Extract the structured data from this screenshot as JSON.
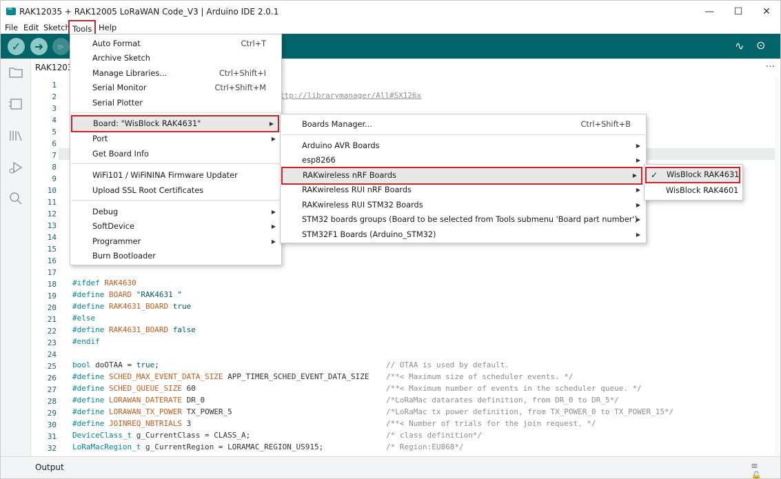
{
  "window": {
    "title": "RAK12035 + RAK12005 LoRaWAN Code_V3 | Arduino IDE 2.0.1",
    "controls": {
      "minimize": "—",
      "maximize": "☐",
      "close": "✕"
    }
  },
  "menubar": {
    "file": "File",
    "edit": "Edit",
    "sketch": "Sketch",
    "tools": "Tools",
    "help": "Help"
  },
  "toolbar": {
    "verify": "✓",
    "upload": "➜",
    "debug": "⊳",
    "serial_plotter": "∿",
    "serial_monitor": "⊙"
  },
  "editor": {
    "tab_name": "RAK12035 + RAK12005 LoRaWAN Code_V3.ino",
    "more_actions": "···",
    "visible_url_fragment": "ttp://librarymanager/All#SX126x",
    "lines": [
      {
        "n": "1"
      },
      {
        "n": "2"
      },
      {
        "n": "3"
      },
      {
        "n": "4"
      },
      {
        "n": "5"
      },
      {
        "n": "6"
      },
      {
        "n": "7"
      },
      {
        "n": "8"
      },
      {
        "n": "9"
      },
      {
        "n": "10"
      },
      {
        "n": "11"
      },
      {
        "n": "12"
      },
      {
        "n": "13"
      },
      {
        "n": "14"
      },
      {
        "n": "15"
      },
      {
        "n": "16"
      },
      {
        "n": "17"
      },
      {
        "n": "18"
      },
      {
        "n": "19"
      },
      {
        "n": "20"
      },
      {
        "n": "21"
      },
      {
        "n": "22"
      },
      {
        "n": "23"
      },
      {
        "n": "24"
      },
      {
        "n": "25"
      },
      {
        "n": "26"
      },
      {
        "n": "27"
      },
      {
        "n": "28"
      },
      {
        "n": "29"
      },
      {
        "n": "30"
      },
      {
        "n": "31"
      },
      {
        "n": "32"
      }
    ],
    "code": {
      "l18": {
        "a": "#ifdef ",
        "b": "RAK4630"
      },
      "l19": {
        "a": "#define ",
        "b": "BOARD ",
        "c": "\"RAK4631 \""
      },
      "l20": {
        "a": "#define ",
        "b": "RAK4631_BOARD ",
        "c": "true"
      },
      "l21": {
        "a": "#else"
      },
      "l22": {
        "a": "#define ",
        "b": "RAK4631_BOARD ",
        "c": "false"
      },
      "l23": {
        "a": "#endif"
      },
      "l25": {
        "a": "bool ",
        "b": "doOTAA = ",
        "c": "true",
        ";": ";",
        "cm": "// OTAA is used by default."
      },
      "l26": {
        "a": "#define ",
        "b": "SCHED_MAX_EVENT_DATA_SIZE ",
        "c": "APP_TIMER_SCHED_EVENT_DATA_SIZE ",
        "cm": "/**< Maximum size of scheduler events. */"
      },
      "l27": {
        "a": "#define ",
        "b": "SCHED_QUEUE_SIZE ",
        "c": "60",
        "cm": "/**< Maximum number of events in the scheduler queue. */"
      },
      "l28": {
        "a": "#define ",
        "b": "LORAWAN_DATERATE ",
        "c": "DR_0",
        "cm": "/*LoRaMac datarates definition, from DR_0 to DR_5*/"
      },
      "l29": {
        "a": "#define ",
        "b": "LORAWAN_TX_POWER ",
        "c": "TX_POWER_5",
        "cm": "/*LoRaMac tx power definition, from TX_POWER_0 to TX_POWER_15*/"
      },
      "l30": {
        "a": "#define ",
        "b": "JOINREQ_NBTRIALS ",
        "c": "3",
        "cm": "/**< Number of trials for the join request. */"
      },
      "l31": {
        "a": "DeviceClass_t ",
        "b": "g_CurrentClass = CLASS_A;",
        "cm": "/* class definition*/"
      },
      "l32": {
        "a": "LoRaMacRegion_t ",
        "b": "g_CurrentRegion = LORAMAC_REGION_US915;",
        "cm": "/* Region:EU868*/"
      }
    }
  },
  "tools_menu": {
    "items": [
      {
        "label": "Auto Format",
        "shortcut": "Ctrl+T"
      },
      {
        "label": "Archive Sketch",
        "shortcut": ""
      },
      {
        "label": "Manage Libraries...",
        "shortcut": "Ctrl+Shift+I"
      },
      {
        "label": "Serial Monitor",
        "shortcut": "Ctrl+Shift+M"
      },
      {
        "label": "Serial Plotter",
        "shortcut": ""
      },
      {
        "label": "Board: \"WisBlock RAK4631\"",
        "shortcut": ""
      },
      {
        "label": "Port",
        "shortcut": ""
      },
      {
        "label": "Get Board Info",
        "shortcut": ""
      },
      {
        "label": "WiFi101 / WiFiNINA Firmware Updater",
        "shortcut": ""
      },
      {
        "label": "Upload SSL Root Certificates",
        "shortcut": ""
      },
      {
        "label": "Debug",
        "shortcut": ""
      },
      {
        "label": "SoftDevice",
        "shortcut": ""
      },
      {
        "label": "Programmer",
        "shortcut": ""
      },
      {
        "label": "Burn Bootloader",
        "shortcut": ""
      }
    ],
    "submenu_arrow": "▶"
  },
  "boards_submenu": {
    "items": [
      {
        "label": "Boards Manager...",
        "shortcut": "Ctrl+Shift+B"
      },
      {
        "label": "Arduino AVR Boards"
      },
      {
        "label": "esp8266"
      },
      {
        "label": "RAKwireless nRF Boards"
      },
      {
        "label": "RAKwireless RUI nRF Boards"
      },
      {
        "label": "RAKwireless RUI STM32 Boards"
      },
      {
        "label": "STM32 boards groups (Board to be selected from Tools submenu 'Board part number')"
      },
      {
        "label": "STM32F1 Boards (Arduino_STM32)"
      }
    ]
  },
  "rak_submenu": {
    "items": [
      {
        "label": "WisBlock RAK4631",
        "checked": true
      },
      {
        "label": "WisBlock RAK4601",
        "checked": false
      }
    ],
    "check_glyph": "✓"
  },
  "output": {
    "label": "Output",
    "icons": "≡ 🔓"
  },
  "colors": {
    "toolbar": "#006468",
    "highlight_border": "#d0202a",
    "keyword": "#00878f",
    "macro": "#c35e1f"
  }
}
